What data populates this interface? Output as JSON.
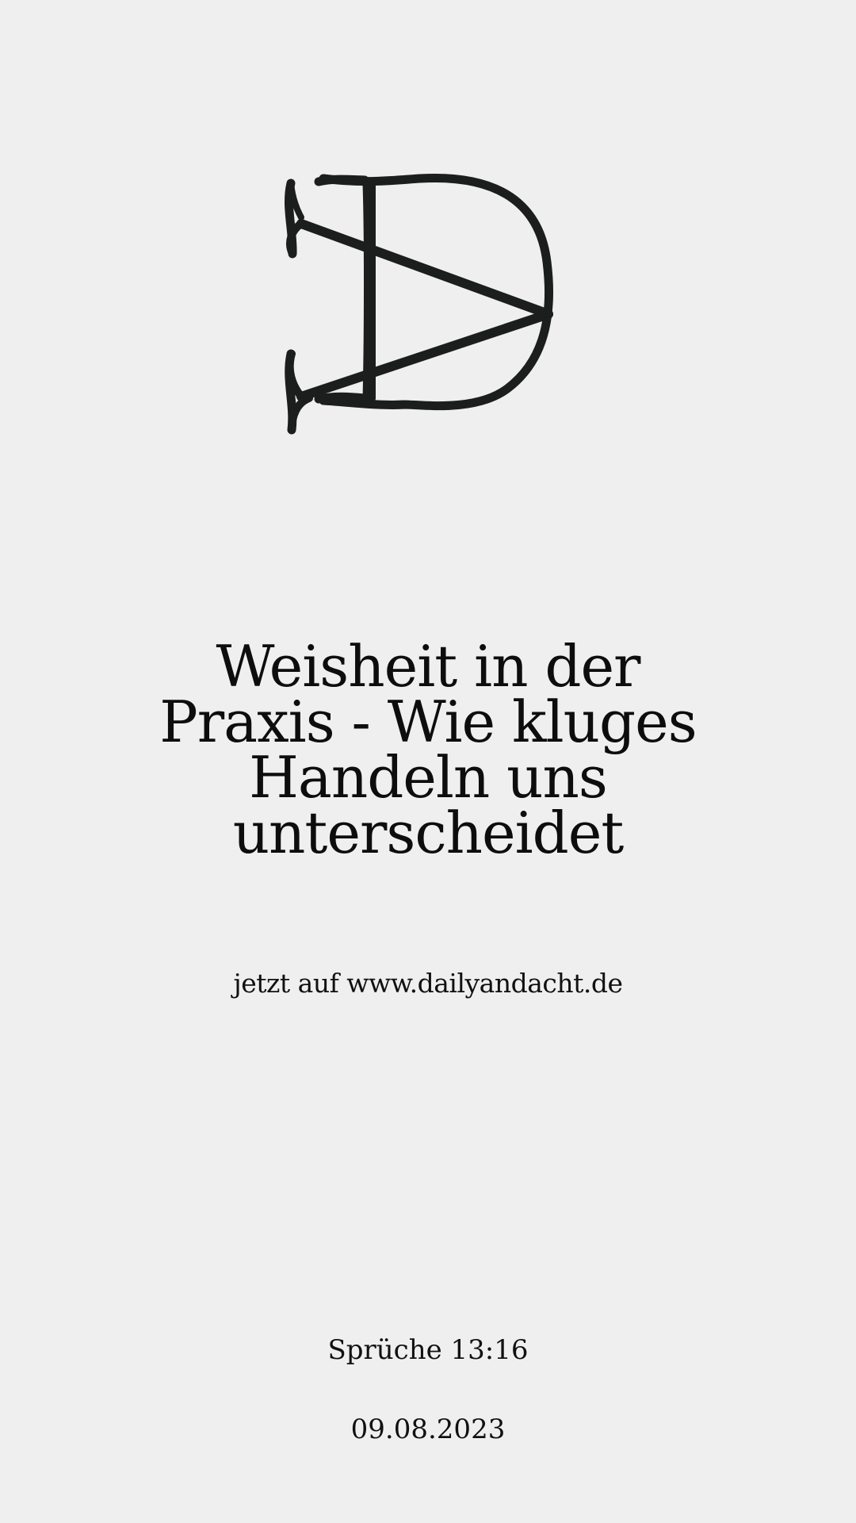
{
  "logo": {
    "icon": "dailyandacht-monogram-logo",
    "color": "#1c1e1d"
  },
  "title": {
    "lines": [
      "Weisheit in der",
      "Praxis - Wie kluges",
      "Handeln uns",
      "unterscheidet"
    ]
  },
  "cta": {
    "text": "jetzt auf www.dailyandacht.de"
  },
  "reference": "Sprüche 13:16",
  "date": "09.08.2023",
  "colors": {
    "background": "#efefef",
    "text": "#0d0d0d"
  }
}
